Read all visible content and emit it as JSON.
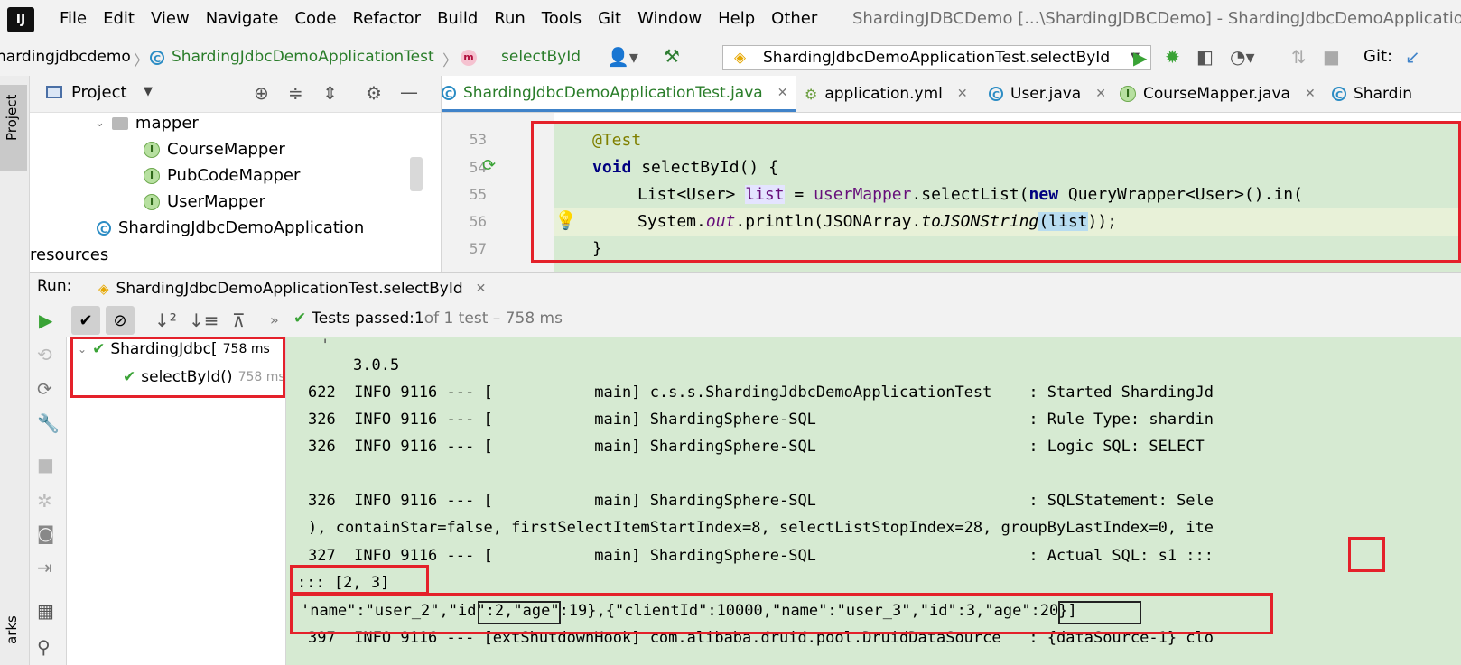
{
  "menu": {
    "items": [
      "File",
      "Edit",
      "View",
      "Navigate",
      "Code",
      "Refactor",
      "Build",
      "Run",
      "Tools",
      "Git",
      "Window",
      "Help",
      "Other"
    ],
    "window_title": "ShardingJDBCDemo [...\\ShardingJDBCDemo] - ShardingJdbcDemoApplication"
  },
  "nav": {
    "crumb_module": "hardingjdbcdemo",
    "crumb_class": "ShardingJdbcDemoApplicationTest",
    "crumb_method": "selectById",
    "run_config": "ShardingJdbcDemoApplicationTest.selectById",
    "git_label": "Git:"
  },
  "sidebar": {
    "project_tab": "Project"
  },
  "project_panel": {
    "title": "Project",
    "tree": [
      {
        "label": "mapper",
        "type": "folder"
      },
      {
        "label": "CourseMapper",
        "type": "interface"
      },
      {
        "label": "PubCodeMapper",
        "type": "interface"
      },
      {
        "label": "UserMapper",
        "type": "interface"
      },
      {
        "label": "ShardingJdbcDemoApplication",
        "type": "class"
      },
      {
        "label": "resources",
        "type": "folder"
      }
    ]
  },
  "editor": {
    "tabs": [
      {
        "label": "ShardingJdbcDemoApplicationTest.java",
        "active": true
      },
      {
        "label": "application.yml",
        "active": false
      },
      {
        "label": "User.java",
        "active": false
      },
      {
        "label": "CourseMapper.java",
        "active": false
      },
      {
        "label": "Shardin",
        "active": false
      }
    ],
    "line_numbers": [
      "53",
      "54",
      "55",
      "56",
      "57"
    ],
    "code": {
      "l53": "@Test",
      "l54_kw": "void",
      "l54_rest": " selectById() {",
      "l55_a": "List<User> ",
      "l55_var": "list",
      "l55_b": " = ",
      "l55_field": "userMapper",
      "l55_c": ".selectList(",
      "l55_new": "new",
      "l55_d": " QueryWrapper<User>().in(",
      "l56_a": "System.",
      "l56_out": "out",
      "l56_b": ".println(JSONArray.",
      "l56_m": "toJSONString",
      "l56_c": "(",
      "l56_arg": "list",
      "l56_d": "));",
      "l57": "}"
    }
  },
  "run_panel": {
    "label": "Run:",
    "tab": "ShardingJdbcDemoApplicationTest.selectById",
    "status_prefix": "Tests passed: ",
    "status_count": "1",
    "status_suffix": " of 1 test – 758 ms",
    "tests": [
      {
        "name": "ShardingJdbc[",
        "time": "758 ms"
      },
      {
        "name": "selectById()",
        "time": "758 ms"
      }
    ]
  },
  "console": {
    "lines": [
      "3.0.5",
      "622  INFO 9116 --- [           main] c.s.s.ShardingJdbcDemoApplicationTest    : Started ShardingJd",
      "326  INFO 9116 --- [           main] ShardingSphere-SQL                       : Rule Type: shardin",
      "326  INFO 9116 --- [           main] ShardingSphere-SQL                       : Logic SQL: SELECT ",
      "",
      "326  INFO 9116 --- [           main] ShardingSphere-SQL                       : SQLStatement: Sele",
      "), containStar=false, firstSelectItemStartIndex=8, selectListStopIndex=28, groupByLastIndex=0, ite",
      "327  INFO 9116 --- [           main] ShardingSphere-SQL                       : Actual SQL: s1 ::: ",
      "::: [2, 3]",
      "'name\":\"user_2\",\"id\":2,\"age\":19},{\"clientId\":10000,\"name\":\"user_3\",\"id\":3,\"age\":20}]",
      "397  INFO 9116 --- [extShutdownHook] com.alibaba.druid.pool.DruidDataSource   : {dataSource-1} clo"
    ]
  },
  "colors": {
    "highlight_green": "#d6ead2",
    "annotation_red": "#e4212a",
    "pass_green": "#3aa336",
    "accent_blue": "#4083c9"
  },
  "bookmarks_label": "arks"
}
